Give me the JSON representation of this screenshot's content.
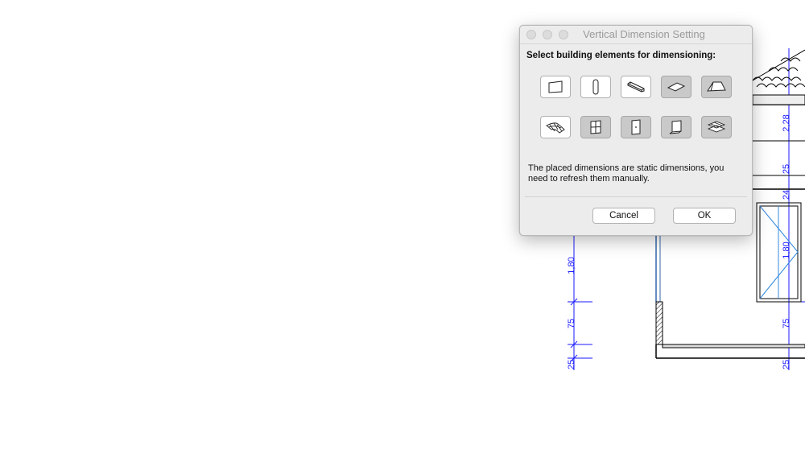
{
  "drawing": {
    "left_dimensions": [
      "1,80",
      "75",
      "25"
    ],
    "right_dimensions": [
      "2,28",
      "25",
      "24",
      "1,80",
      "75",
      "25"
    ],
    "colors": {
      "dimension": "#1a1aff",
      "lines": "#000000"
    }
  },
  "dialog": {
    "title": "Vertical Dimension Setting",
    "heading": "Select building elements for dimensioning:",
    "elements": [
      {
        "icon": "wall-icon",
        "selected": false
      },
      {
        "icon": "column-icon",
        "selected": false
      },
      {
        "icon": "beam-icon",
        "selected": false
      },
      {
        "icon": "slab-icon",
        "selected": true
      },
      {
        "icon": "roof-icon",
        "selected": true
      },
      {
        "icon": "mesh-icon",
        "selected": false
      },
      {
        "icon": "window-icon",
        "selected": true
      },
      {
        "icon": "door-icon",
        "selected": true
      },
      {
        "icon": "curtain-wall-icon",
        "selected": true
      },
      {
        "icon": "stair-icon",
        "selected": true
      }
    ],
    "note": "The placed dimensions are static dimensions, you need to refresh them manually.",
    "cancel_label": "Cancel",
    "ok_label": "OK"
  }
}
